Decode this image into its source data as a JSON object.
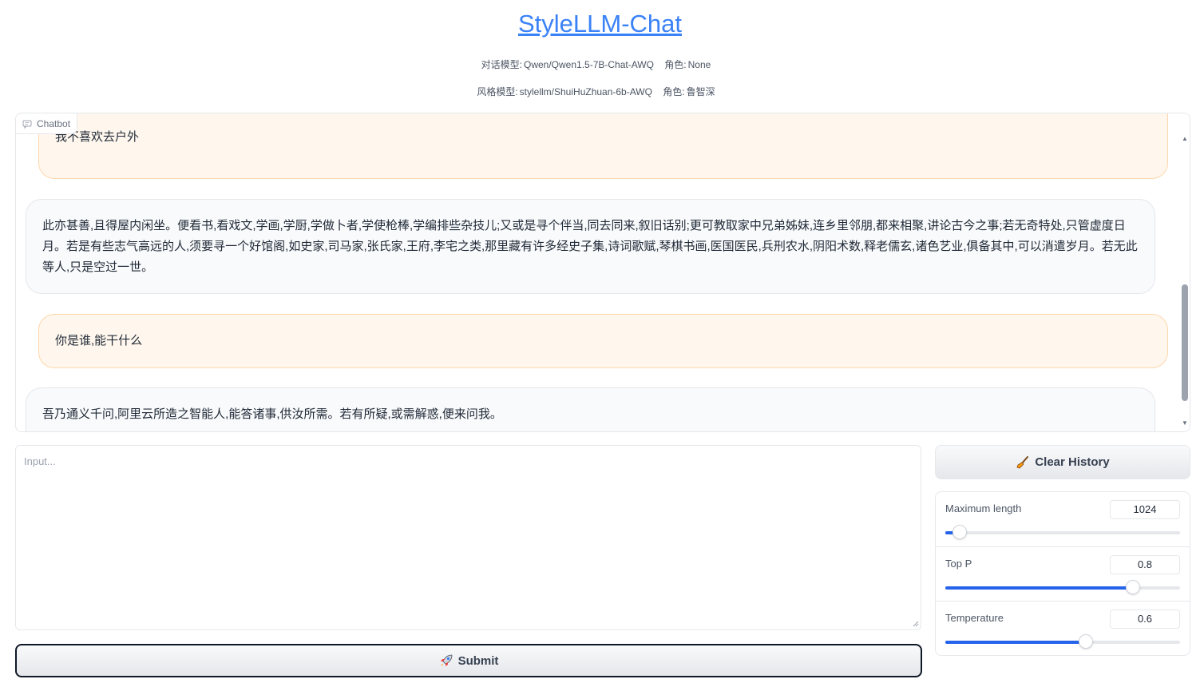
{
  "app": {
    "title": "StyleLLM-Chat",
    "chat_model_label": "对话模型:",
    "chat_model_value": "Qwen/Qwen1.5-7B-Chat-AWQ",
    "chat_role_label": "角色:",
    "chat_role_value": "None",
    "style_model_label": "风格模型:",
    "style_model_value": "stylellm/ShuiHuZhuan-6b-AWQ",
    "style_role_label": "角色:",
    "style_role_value": "鲁智深"
  },
  "chatbot": {
    "label": "Chatbot",
    "messages": [
      {
        "role": "user",
        "text": "我不喜欢去户外"
      },
      {
        "role": "bot",
        "text": "此亦甚善,且得屋内闲坐。便看书,看戏文,学画,学厨,学做卜者,学使枪棒,学编排些杂技儿;又或是寻个伴当,同去同来,叙旧话别;更可教取家中兄弟姊妹,连乡里邻朋,都来相聚,讲论古今之事;若无奇特处,只管虚度日月。若是有些志气高远的人,须要寻一个好馆阁,如史家,司马家,张氏家,王府,李宅之类,那里藏有许多经史子集,诗词歌赋,琴棋书画,医国医民,兵刑农水,阴阳术数,释老儒玄,诸色艺业,俱备其中,可以消遣岁月。若无此等人,只是空过一世。"
      },
      {
        "role": "user",
        "text": "你是谁,能干什么"
      },
      {
        "role": "bot",
        "text": "吾乃通义千问,阿里云所造之智能人,能答诸事,供汝所需。若有所疑,或需解惑,便来问我。"
      }
    ]
  },
  "input": {
    "placeholder": "Input...",
    "value": ""
  },
  "buttons": {
    "submit": "Submit",
    "clear": "Clear History"
  },
  "params": [
    {
      "label": "Maximum length",
      "value": "1024",
      "fraction": 0.06
    },
    {
      "label": "Top P",
      "value": "0.8",
      "fraction": 0.8
    },
    {
      "label": "Temperature",
      "value": "0.6",
      "fraction": 0.6
    }
  ],
  "colors": {
    "accent": "#2563eb",
    "title": "#3b82f6",
    "user_bubble": "#fff7ed",
    "bot_bubble": "#f9fafb"
  }
}
